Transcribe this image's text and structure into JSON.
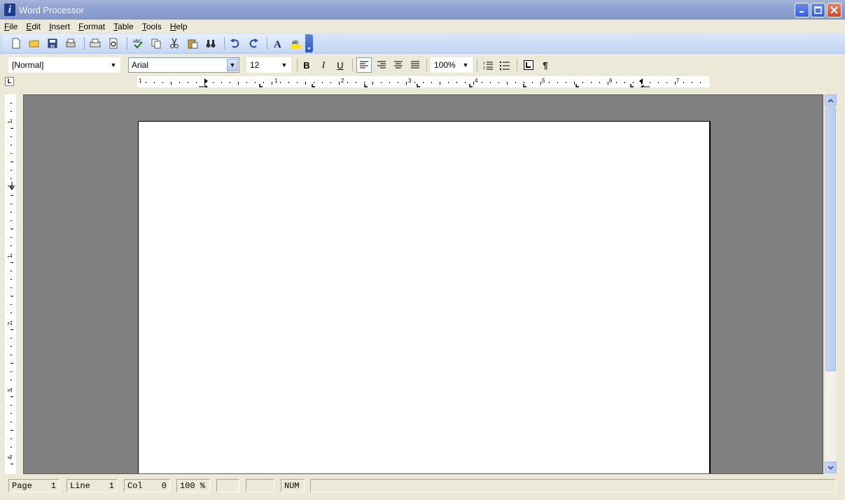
{
  "window": {
    "title": "Word Processor",
    "app_icon": "i"
  },
  "menu": [
    {
      "key": "F",
      "rest": "ile"
    },
    {
      "key": "E",
      "rest": "dit"
    },
    {
      "key": "I",
      "rest": "nsert"
    },
    {
      "key": "F",
      "rest": "ormat"
    },
    {
      "key": "T",
      "rest": "able"
    },
    {
      "key": "T",
      "rest": "ools"
    },
    {
      "key": "H",
      "rest": "elp"
    }
  ],
  "formatting": {
    "style": "[Normal]",
    "font": "Arial",
    "size": "12",
    "bold": "B",
    "italic": "I",
    "underline": "U",
    "zoom": "100%",
    "pilcrow": "¶"
  },
  "ruler": {
    "horizontal_numbers": [
      "1",
      "1",
      "2",
      "3",
      "4",
      "5",
      "6",
      "7"
    ],
    "vertical_numbers": [
      "1",
      "1",
      "2",
      "3",
      "4"
    ],
    "tab_stop_symbol": "L"
  },
  "status": {
    "page_label": "Page",
    "page_value": "1",
    "line_label": "Line",
    "line_value": "1",
    "col_label": "Col",
    "col_value": "0",
    "zoom_label": "100 %",
    "num_indicator": "NUM"
  },
  "colors": {
    "titlebar": "#8ea1d0",
    "toolbar": "#c6d8f6",
    "workspace": "#808080",
    "page": "#ffffff"
  }
}
